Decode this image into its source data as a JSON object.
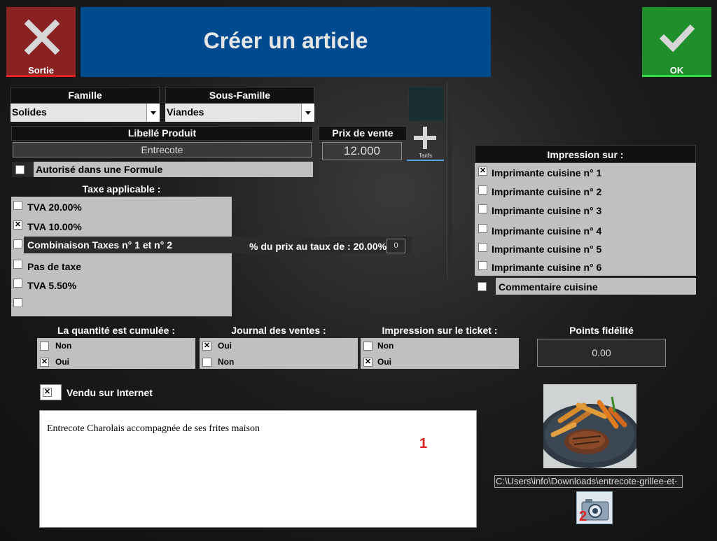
{
  "header": {
    "exit_label": "Sortie",
    "title": "Créer un article",
    "ok_label": "OK"
  },
  "famille": {
    "label": "Famille",
    "value": "Solides"
  },
  "sous_famille": {
    "label": "Sous-Famille",
    "value": "Viandes"
  },
  "libelle": {
    "label": "Libellé Produit",
    "value": "Entrecote"
  },
  "prix": {
    "label": "Prix de vente",
    "value": "12.000"
  },
  "tarifs": {
    "label": "Tarifs"
  },
  "formule": {
    "label": "Autorisé dans une Formule",
    "checked": ""
  },
  "taxe": {
    "label": "Taxe applicable :",
    "items": [
      {
        "label": "TVA 20.00%",
        "mark": ""
      },
      {
        "label": "TVA 10.00%",
        "mark": "✕"
      },
      {
        "label": "Combinaison Taxes n° 1 et n° 2",
        "mark": ""
      },
      {
        "label": "Pas de taxe",
        "mark": ""
      },
      {
        "label": "TVA 5.50%",
        "mark": ""
      },
      {
        "label": "",
        "mark": ""
      }
    ],
    "combo_label": "% du prix au taux de : 20.00% :",
    "combo_value": "0"
  },
  "impression": {
    "label": "Impression sur :",
    "items": [
      {
        "label": "Imprimante cuisine n° 1",
        "mark": "✕"
      },
      {
        "label": "Imprimante cuisine n° 2",
        "mark": ""
      },
      {
        "label": "Imprimante cuisine n° 3",
        "mark": ""
      },
      {
        "label": "Imprimante cuisine n° 4",
        "mark": ""
      },
      {
        "label": "Imprimante cuisine n° 5",
        "mark": ""
      },
      {
        "label": "Imprimante cuisine n° 6",
        "mark": ""
      }
    ],
    "commentaire": {
      "label": "Commentaire cuisine",
      "mark": ""
    }
  },
  "quantite": {
    "label": "La quantité est cumulée :",
    "non": "Non",
    "oui": "Oui",
    "non_mark": "",
    "oui_mark": "✕"
  },
  "journal": {
    "label": "Journal des ventes :",
    "oui": "Oui",
    "non": "Non",
    "oui_mark": "✕",
    "non_mark": ""
  },
  "ticket": {
    "label": "Impression sur le  ticket :",
    "non": "Non",
    "oui": "Oui",
    "non_mark": "",
    "oui_mark": "✕"
  },
  "fidelite": {
    "label": "Points fidélité",
    "value": "0.00"
  },
  "internet": {
    "label": "Vendu sur Internet",
    "mark": "✕"
  },
  "description": {
    "value": "Entrecote Charolais accompagnée de ses frites maison",
    "marker": "1"
  },
  "image": {
    "path": "C:\\Users\\info\\Downloads\\entrecote-grillee-et-",
    "camera_marker": "2"
  },
  "colors": {
    "exit": "#8b2020",
    "title": "#004a8f",
    "ok": "#1e8f2a"
  }
}
